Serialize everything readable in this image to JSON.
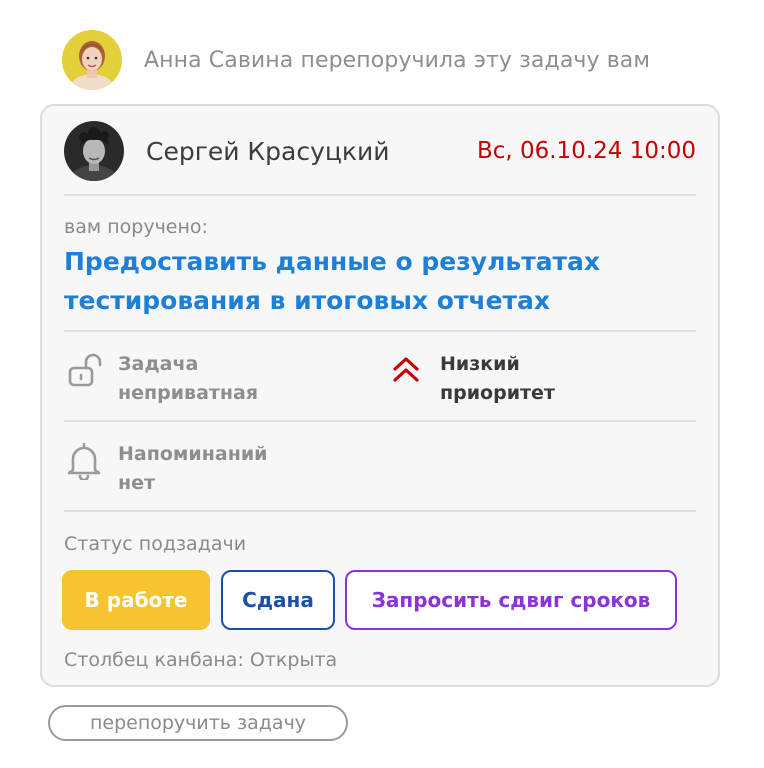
{
  "notification": {
    "text": "Анна Савина перепоручила эту задачу вам"
  },
  "task": {
    "assignee_name": "Сергей Красуцкий",
    "due": "Вс, 06.10.24 10:00",
    "assigned_label": "вам поручено:",
    "title": "Предоставить данные о результатах тестирования в итоговых отчетах",
    "privacy": {
      "line1": "Задача",
      "line2": "неприватная",
      "icon": "unlock-icon"
    },
    "priority": {
      "line1": "Низкий",
      "line2": "приоритет",
      "icon": "chevrons-up-icon",
      "color": "#c40000"
    },
    "reminders": {
      "line1": "Напоминаний",
      "line2": "нет",
      "icon": "bell-icon"
    },
    "status_label": "Статус подзадачи",
    "status_buttons": {
      "in_work": "В работе",
      "done": "Сдана",
      "request_shift": "Запросить сдвиг сроков"
    },
    "kanban": "Столбец канбана: Открыта"
  },
  "actions": {
    "reassign": "перепоручить задачу"
  },
  "colors": {
    "accent_blue": "#1e7fd6",
    "due_red": "#c40000",
    "in_work_yellow": "#f5c430",
    "done_blue": "#1b4fa8",
    "shift_purple": "#8a33d6"
  }
}
